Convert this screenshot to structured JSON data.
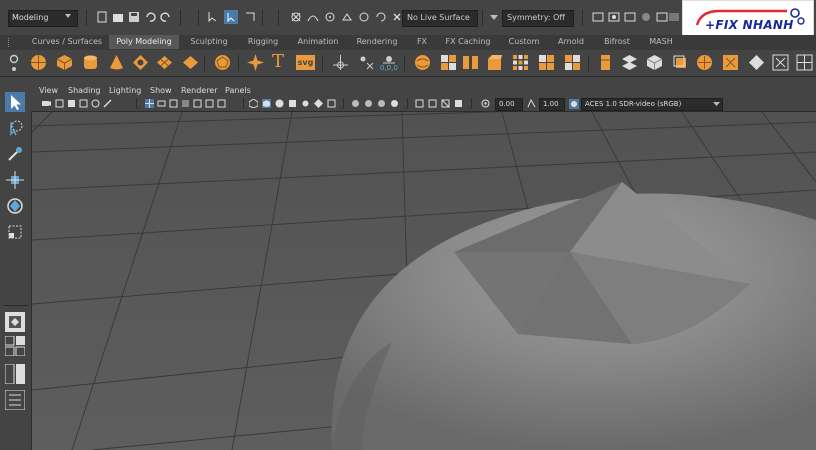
{
  "status_line": {
    "menu_set": "Modeling",
    "live_surface": "No Live Surface",
    "symmetry": "Symmetry: Off"
  },
  "logo": {
    "text": "+FIX NHANH",
    "colors": {
      "primary": "#1a2a9a",
      "accent": "#e8262d"
    }
  },
  "shelf": {
    "tabs": [
      "Curves / Surfaces",
      "Poly Modeling",
      "Sculpting",
      "Rigging",
      "Animation",
      "Rendering",
      "FX",
      "FX Caching",
      "Custom",
      "Arnold",
      "Bifrost",
      "MASH"
    ],
    "active_tab": "Poly Modeling",
    "icons": [
      "poly-sphere-icon",
      "poly-cube-icon",
      "poly-cylinder-icon",
      "poly-cone-icon",
      "poly-torus-icon",
      "poly-plane-icon",
      "poly-disc-icon",
      "platonic-icon",
      "star-icon",
      "type-icon",
      "svg-icon",
      "separate-icon",
      "uv-coords-icon",
      "combine-icon",
      "extract-icon",
      "bridge-icon",
      "extrude-icon",
      "bevel-icon",
      "append-icon",
      "fill-hole-icon",
      "merge-icon",
      "insert-edge-loop-icon",
      "multi-cut-icon",
      "target-weld-icon",
      "mirror-icon",
      "smooth-icon",
      "reduce-icon",
      "triangulate-icon",
      "quadrangulate-icon"
    ],
    "svg_label": "svg",
    "type_label": "T",
    "coords_label": "0,0,0"
  },
  "panel": {
    "menu": [
      "View",
      "Shading",
      "Lighting",
      "Show",
      "Renderer",
      "Panels"
    ],
    "near_clip": "0.00",
    "far_clip": "1.00",
    "color_space": "ACES 1.0 SDR-video (sRGB)"
  },
  "colors": {
    "ui_bg": "#444444",
    "viewport_bg": "#595959",
    "active_tab": "#575757",
    "shelf_orange": "#e89a3c",
    "tool_blue": "#5fa8d6"
  }
}
